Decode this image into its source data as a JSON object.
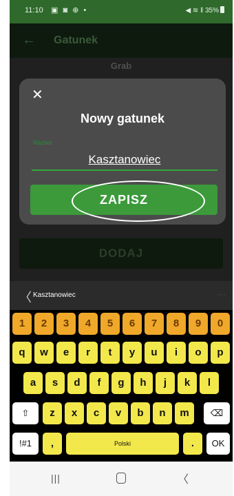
{
  "status_bar": {
    "time": "11:10",
    "icons": "▣ ◙ ⊕ •",
    "right": "◀ ≋ ‖ 35%"
  },
  "app_bar": {
    "back_glyph": "←",
    "title": "Gatunek"
  },
  "background": {
    "row_text": "Grab",
    "add_button_label": "DODAJ"
  },
  "dialog": {
    "close_glyph": "✕",
    "title": "Nowy gatunek",
    "field_label": "Nazwa",
    "field_value": "Kasztanowiec",
    "save_label": "ZAPISZ"
  },
  "keyboard": {
    "suggestion": "Kasztanowiec",
    "back_glyph": "〈",
    "more_glyph": "···",
    "num_row": [
      "1",
      "2",
      "3",
      "4",
      "5",
      "6",
      "7",
      "8",
      "9",
      "0"
    ],
    "row1": [
      "q",
      "w",
      "e",
      "r",
      "t",
      "y",
      "u",
      "i",
      "o",
      "p"
    ],
    "row2": [
      "a",
      "s",
      "d",
      "f",
      "g",
      "h",
      "j",
      "k",
      "l"
    ],
    "row3": [
      "z",
      "x",
      "c",
      "v",
      "b",
      "n",
      "m"
    ],
    "shift_glyph": "⇧",
    "backspace_glyph": "⌫",
    "symbols_label": "!#1",
    "comma_label": ",",
    "space_label": "Polski",
    "period_label": ".",
    "ok_label": "OK"
  },
  "nav_bar": {
    "recents_glyph": "|||",
    "back_glyph": "〈"
  },
  "colors": {
    "accent": "#3c9a3b",
    "status_bar": "#2f6a2c",
    "key_letter": "#f3e84b",
    "key_number": "#f0a82a"
  }
}
